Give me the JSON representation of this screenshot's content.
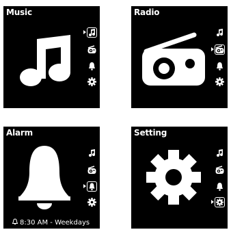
{
  "screens": {
    "music": {
      "title": "Music",
      "hero_icon": "music-note-icon",
      "selected_menu": "music"
    },
    "radio": {
      "title": "Radio",
      "hero_icon": "radio-icon",
      "selected_menu": "radio"
    },
    "alarm": {
      "title": "Alarm",
      "hero_icon": "bell-icon",
      "selected_menu": "alarm",
      "status": "8:30 AM - Weekdays",
      "status_icon": "bell-outline-icon"
    },
    "setting": {
      "title": "Setting",
      "hero_icon": "gear-icon",
      "selected_menu": "setting"
    }
  },
  "menu_items": [
    {
      "id": "music",
      "icon": "music-note-icon"
    },
    {
      "id": "radio",
      "icon": "radio-icon"
    },
    {
      "id": "alarm",
      "icon": "bell-icon"
    },
    {
      "id": "setting",
      "icon": "gear-icon"
    }
  ],
  "colors": {
    "background": "#000000",
    "foreground": "#ffffff",
    "page": "#ffffff"
  }
}
